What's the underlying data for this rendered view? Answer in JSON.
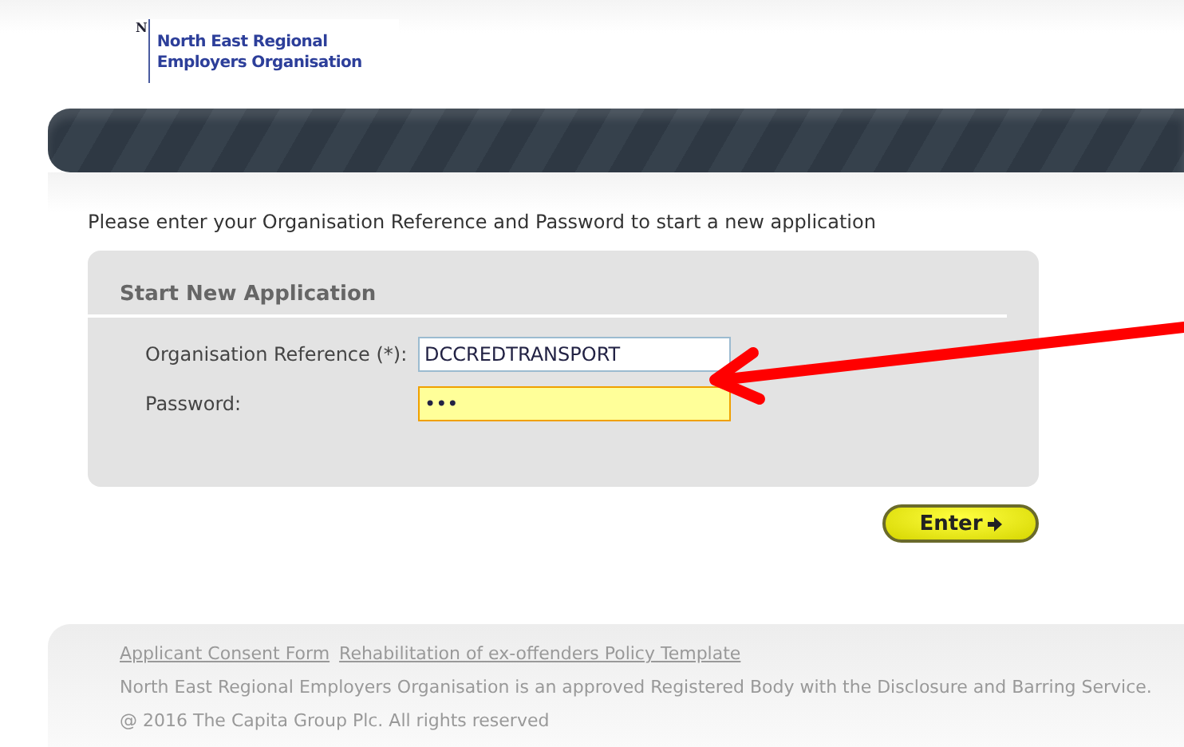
{
  "logo": {
    "letter": "N",
    "lines": [
      "North East Regional",
      "Employers Organisation"
    ]
  },
  "intro": "Please enter your Organisation Reference and Password to start a new application",
  "form": {
    "title": "Start New Application",
    "fields": [
      {
        "label": "Organisation Reference (*):",
        "value": "DCCREDTRANSPORT",
        "focused": false
      },
      {
        "label": "Password:",
        "value": "•••",
        "focused": true
      }
    ]
  },
  "enter_button": {
    "label": "Enter"
  },
  "footer": {
    "links": [
      "Applicant Consent Form",
      "Rehabilitation of ex-offenders Policy Template"
    ],
    "notice": "North East Regional Employers Organisation is an approved Registered Body with the Disclosure and Barring Service.",
    "copyright": "@ 2016 The Capita Group Plc. All rights reserved"
  },
  "annotation": {
    "kind": "arrow"
  }
}
